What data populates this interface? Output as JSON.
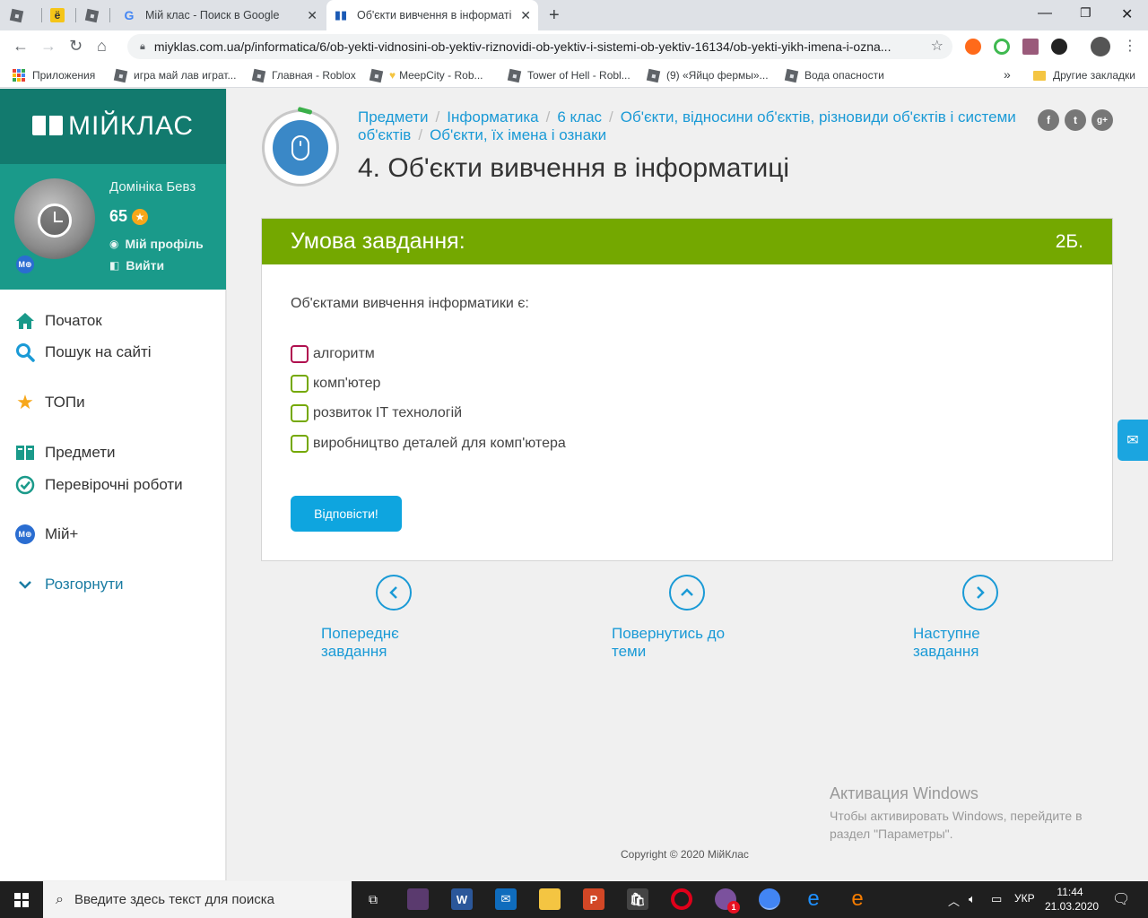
{
  "browser": {
    "tabs": [
      {
        "title": ""
      },
      {
        "title": ""
      },
      {
        "title": ""
      },
      {
        "title": "Мій клас - Поиск в Google"
      },
      {
        "title": "Об'єкти вивчення в інформаті..."
      }
    ],
    "url": "miyklas.com.ua/p/informatica/6/ob-yekti-vidnosini-ob-yektiv-riznovidi-ob-yektiv-i-sistemi-ob-yektiv-16134/ob-yekti-yikh-imena-i-ozna...",
    "bookmarks": [
      {
        "label": "Приложения"
      },
      {
        "label": "игра май лав играт..."
      },
      {
        "label": "Главная - Roblox"
      },
      {
        "label": "MeepCity - Rob..."
      },
      {
        "label": "Tower of Hell - Robl..."
      },
      {
        "label": "(9) «Яйцо фермы»..."
      },
      {
        "label": "Вода опасности"
      }
    ],
    "other_bookmarks": "Другие закладки",
    "more": "»"
  },
  "sidebar": {
    "logo": "МІЙКЛАС",
    "user": {
      "name": "Домініка Бевз",
      "score": "65",
      "badge": "М⊕",
      "profile_link": "Мій профіль",
      "logout_link": "Вийти"
    },
    "menu": [
      {
        "label": "Початок",
        "icon": "home-icon"
      },
      {
        "label": "Пошук на сайті",
        "icon": "search-icon"
      },
      {
        "label": "ТОПи",
        "icon": "star-icon"
      },
      {
        "label": "Предмети",
        "icon": "book-icon"
      },
      {
        "label": "Перевірочні роботи",
        "icon": "check-circle-icon"
      },
      {
        "label": "Мій+",
        "icon": "myplus-icon"
      },
      {
        "label": "Розгорнути",
        "icon": "chevron-down-icon"
      }
    ]
  },
  "main": {
    "breadcrumb": {
      "items": [
        "Предмети",
        "Інформатика",
        "6 клас",
        "Об'єкти, відносини об'єктів, різновиди об'єктів і системи об'єктів",
        "Об'єкти, їх імена і ознаки"
      ]
    },
    "title": "4. Об'єкти вивчення в інформатиці",
    "task": {
      "header": "Умова завдання:",
      "points": "2Б.",
      "question": "Об'єктами вивчення інформатики є:",
      "options": [
        "алгоритм",
        "комп'ютер",
        "розвиток IT технологій",
        "виробництво деталей для комп'ютера"
      ],
      "answer_button": "Відповісти!"
    },
    "nav": {
      "prev": "Попереднє завдання",
      "back": "Повернутись до теми",
      "next": "Наступне завдання"
    },
    "activation": {
      "title": "Активация Windows",
      "text": "Чтобы активировать Windows, перейдите в раздел \"Параметры\"."
    },
    "copyright": "Copyright © 2020 МійКлас"
  },
  "taskbar": {
    "search_placeholder": "Введите здесь текст для поиска",
    "language": "УКР",
    "time": "11:44",
    "date": "21.03.2020",
    "viber_badge": "1"
  },
  "colors": {
    "teal_dark": "#127a6e",
    "teal": "#1a9a8a",
    "task_green": "#74a800",
    "link_blue": "#1a9ad6",
    "button_blue": "#0ea5df"
  }
}
